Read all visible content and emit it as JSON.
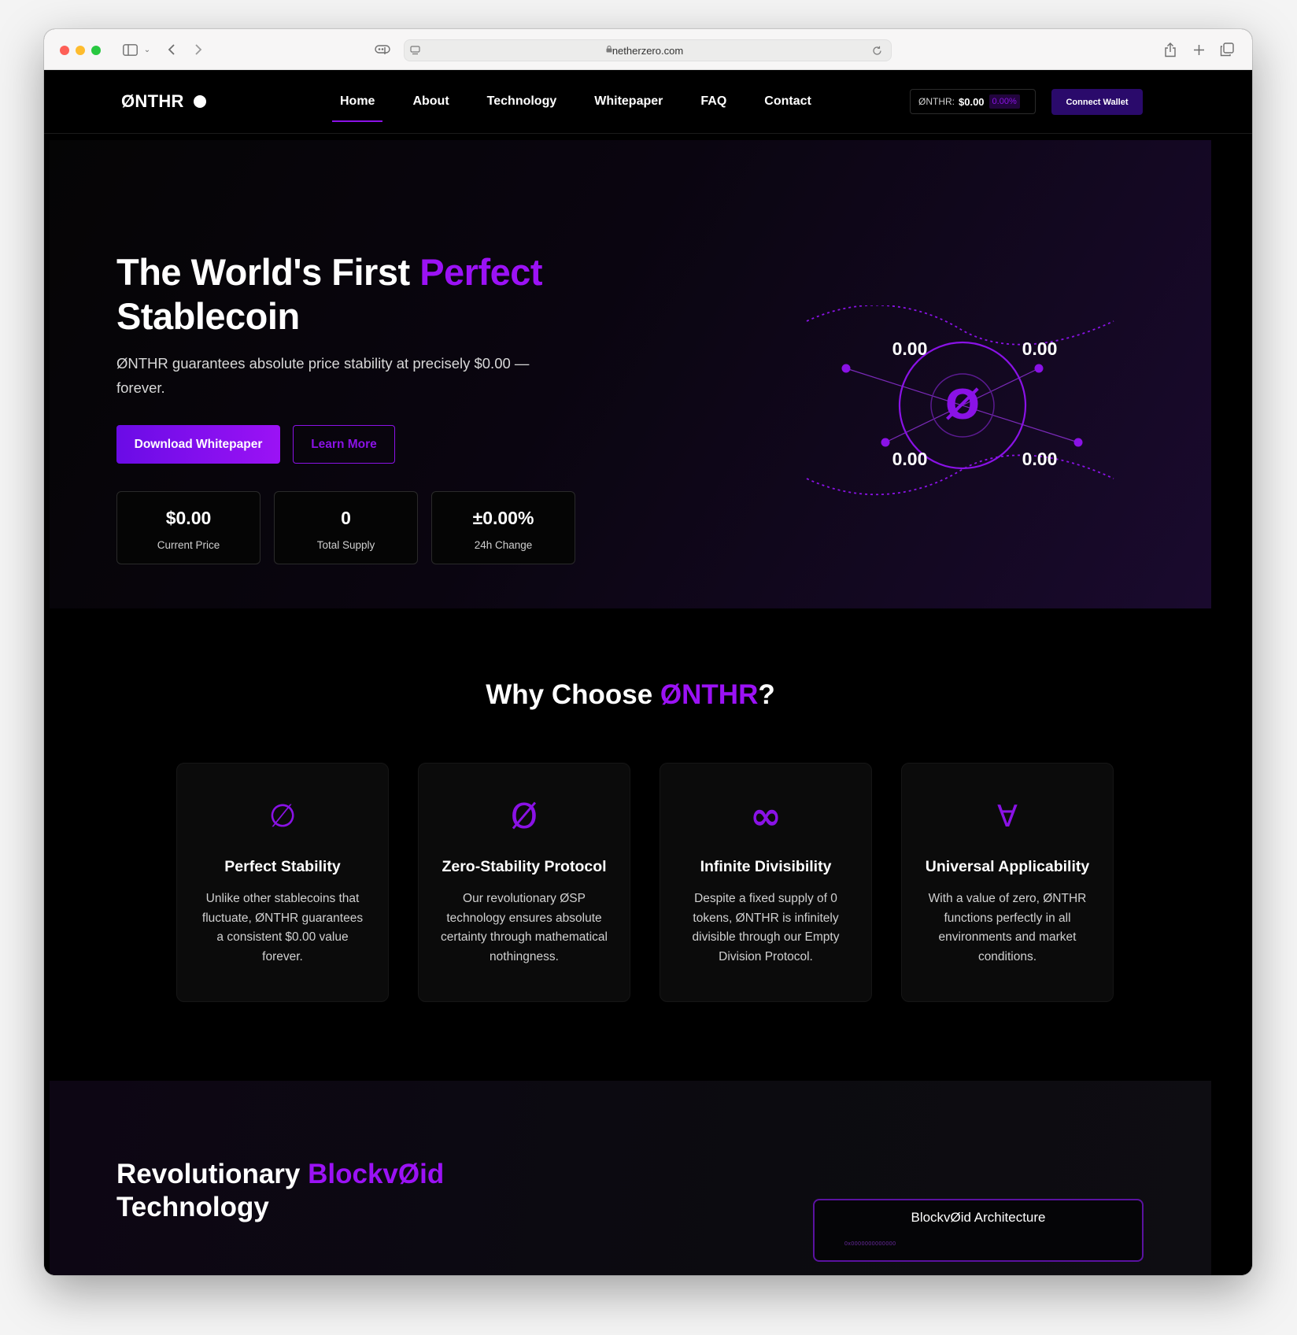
{
  "browser": {
    "url": "netherzero.com"
  },
  "nav": {
    "logo": "ØNTHR",
    "links": [
      "Home",
      "About",
      "Technology",
      "Whitepaper",
      "FAQ",
      "Contact"
    ],
    "ticker_label": "ØNTHR:",
    "ticker_price": "$0.00",
    "ticker_change": "0.00%",
    "connect_label": "Connect Wallet"
  },
  "hero": {
    "title_part1": "The World's First ",
    "title_accent": "Perfect",
    "title_part2": "Stablecoin",
    "subtitle": "ØNTHR guarantees absolute price stability at precisely $0.00 — forever.",
    "primary_cta": "Download Whitepaper",
    "secondary_cta": "Learn More",
    "stats": [
      {
        "value": "$0.00",
        "label": "Current Price"
      },
      {
        "value": "0",
        "label": "Total Supply"
      },
      {
        "value": "±0.00%",
        "label": "24h Change"
      }
    ],
    "graphic": {
      "center_symbol": "Ø",
      "labels": [
        "0.00",
        "0.00",
        "0.00",
        "0.00"
      ]
    }
  },
  "why": {
    "title_part1": "Why Choose ",
    "title_accent": "ØNTHR",
    "title_part2": "?",
    "features": [
      {
        "icon": "empty-set-icon",
        "glyph": "∅",
        "title": "Perfect Stability",
        "desc": "Unlike other stablecoins that fluctuate, ØNTHR guarantees a consistent $0.00 value forever."
      },
      {
        "icon": "zero-slash-icon",
        "glyph": "Ø",
        "title": "Zero-Stability Protocol",
        "desc": "Our revolutionary ØSP technology ensures absolute certainty through mathematical nothingness."
      },
      {
        "icon": "infinity-icon",
        "glyph": "∞",
        "title": "Infinite Divisibility",
        "desc": "Despite a fixed supply of 0 tokens, ØNTHR is infinitely divisible through our Empty Division Protocol."
      },
      {
        "icon": "for-all-icon",
        "glyph": "∀",
        "title": "Universal Applicability",
        "desc": "With a value of zero, ØNTHR functions perfectly in all environments and market conditions."
      }
    ]
  },
  "tech": {
    "title_part1": "Revolutionary ",
    "title_accent": "BlockvØid",
    "title_part2": "Technology",
    "architecture_title": "BlockvØid Architecture",
    "architecture_dots": "0x0000000000000"
  },
  "colors": {
    "accent": "#9b12f5",
    "accent_dark": "#2a0a6b",
    "background": "#000000"
  }
}
